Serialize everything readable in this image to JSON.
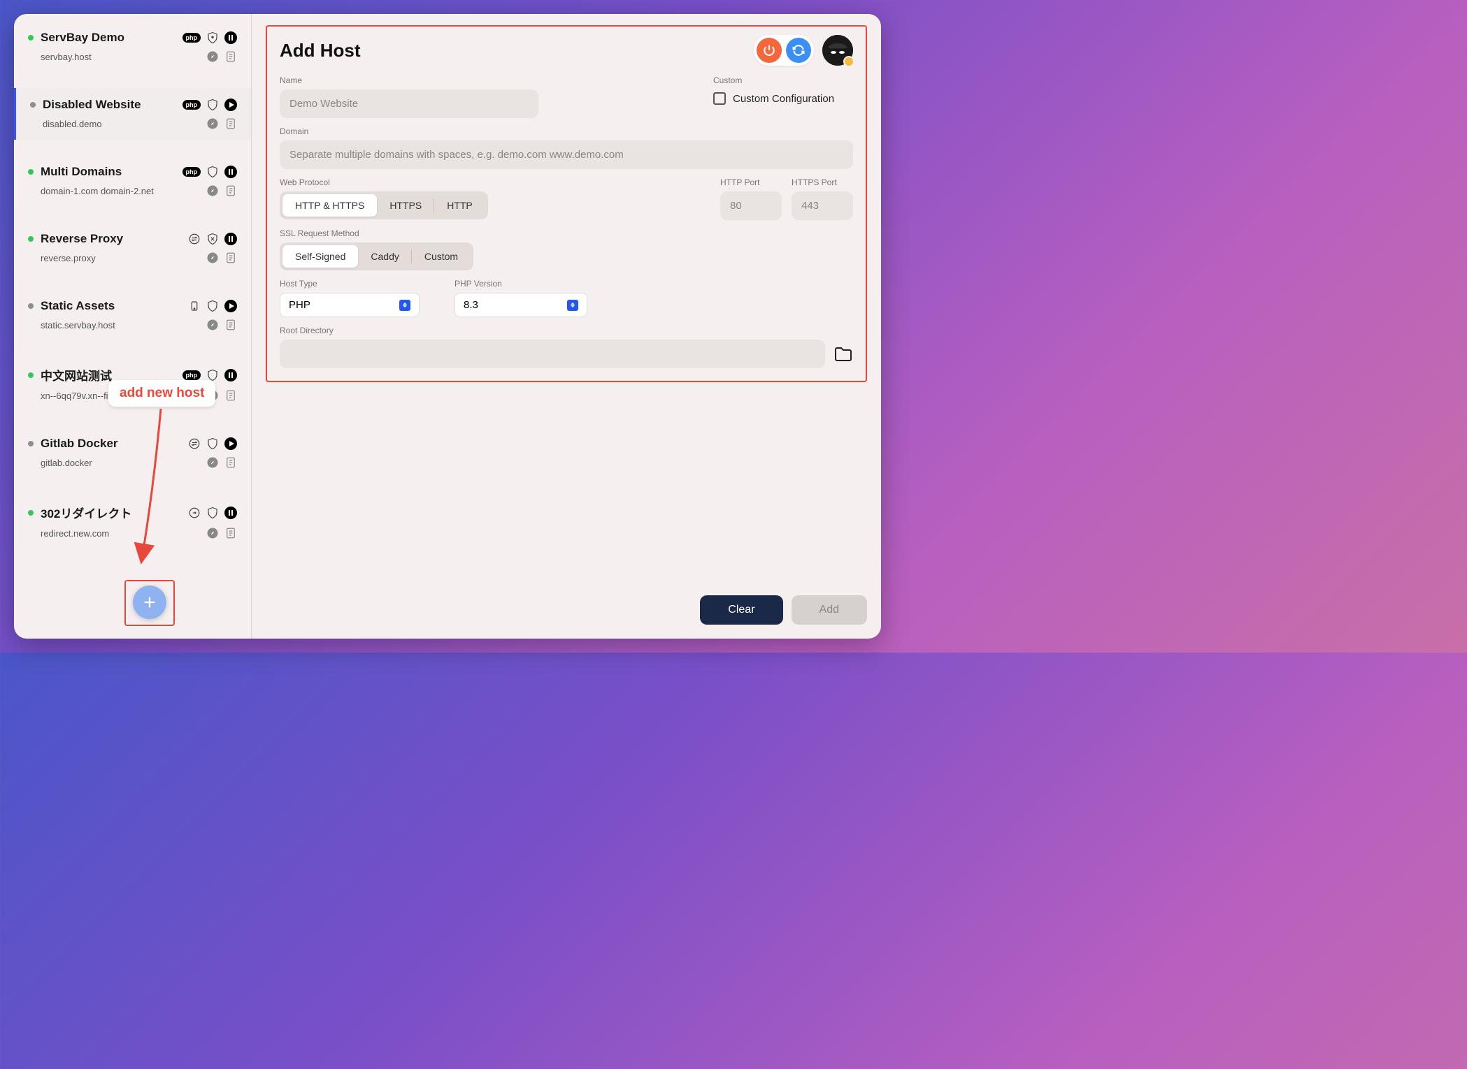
{
  "sidebar": {
    "hosts": [
      {
        "name": "ServBay Demo",
        "domain": "servbay.host",
        "status": "green",
        "badge": "php",
        "icon1": "shield-lock",
        "icon2": "pause",
        "icon3": "compass",
        "icon4": "note"
      },
      {
        "name": "Disabled Website",
        "domain": "disabled.demo",
        "status": "gray",
        "badge": "php",
        "icon1": "shield",
        "icon2": "play",
        "icon3": "compass",
        "icon4": "note",
        "selected": true
      },
      {
        "name": "Multi Domains",
        "domain": "domain-1.com domain-2.net",
        "status": "green",
        "badge": "php",
        "icon1": "shield",
        "icon2": "pause",
        "icon3": "compass",
        "icon4": "note"
      },
      {
        "name": "Reverse Proxy",
        "domain": "reverse.proxy",
        "status": "green",
        "badge": "swap",
        "icon1": "shield-x",
        "icon2": "pause",
        "icon3": "compass",
        "icon4": "note"
      },
      {
        "name": "Static Assets",
        "domain": "static.servbay.host",
        "status": "gray",
        "badge": "device",
        "icon1": "shield",
        "icon2": "play",
        "icon3": "compass",
        "icon4": "note"
      },
      {
        "name": "中文网站测试",
        "domain": "xn--6qq79v.xn--fiqs8s",
        "status": "green",
        "badge": "php",
        "icon1": "shield",
        "icon2": "pause",
        "icon3": "compass",
        "icon4": "note"
      },
      {
        "name": "Gitlab Docker",
        "domain": "gitlab.docker",
        "status": "gray",
        "badge": "swap",
        "icon1": "shield",
        "icon2": "play",
        "icon3": "compass",
        "icon4": "note"
      },
      {
        "name": "302リダイレクト",
        "domain": "redirect.new.com",
        "status": "green",
        "badge": "redirect",
        "icon1": "shield",
        "icon2": "pause",
        "icon3": "compass",
        "icon4": "note"
      }
    ]
  },
  "tooltip": "add new host",
  "main": {
    "title": "Add Host",
    "labels": {
      "name": "Name",
      "custom": "Custom",
      "custom_config": "Custom Configuration",
      "domain": "Domain",
      "web_protocol": "Web Protocol",
      "http_port": "HTTP Port",
      "https_port": "HTTPS Port",
      "ssl_method": "SSL Request Method",
      "host_type": "Host Type",
      "php_version": "PHP Version",
      "root_dir": "Root Directory"
    },
    "placeholders": {
      "name": "Demo Website",
      "domain": "Separate multiple domains with spaces, e.g. demo.com www.demo.com",
      "http_port": "80",
      "https_port": "443"
    },
    "protocol": {
      "options": [
        "HTTP & HTTPS",
        "HTTPS",
        "HTTP"
      ],
      "active": 0
    },
    "ssl": {
      "options": [
        "Self-Signed",
        "Caddy",
        "Custom"
      ],
      "active": 0
    },
    "host_type_value": "PHP",
    "php_version_value": "8.3"
  },
  "footer": {
    "clear": "Clear",
    "add": "Add"
  }
}
